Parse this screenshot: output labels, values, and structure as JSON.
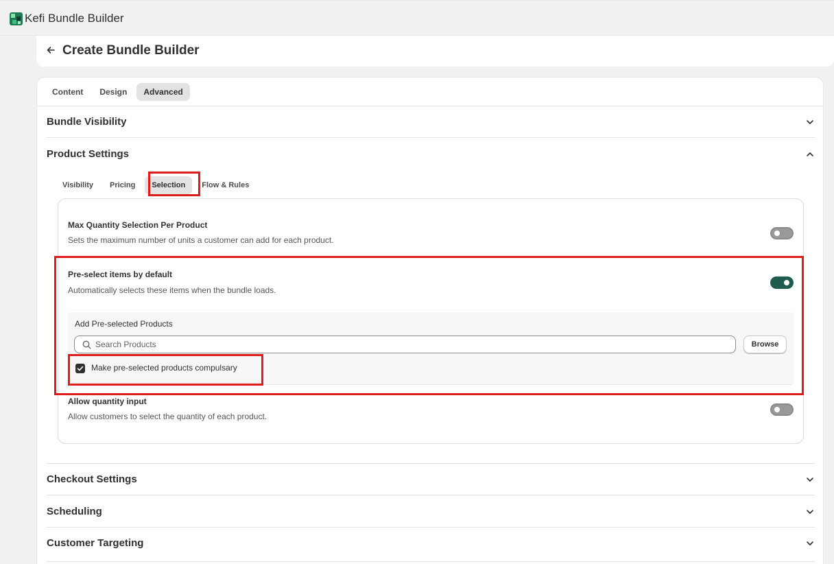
{
  "app": {
    "title": "Kefi Bundle Builder"
  },
  "page": {
    "title": "Create Bundle Builder"
  },
  "tabs": [
    {
      "label": "Content",
      "active": false
    },
    {
      "label": "Design",
      "active": false
    },
    {
      "label": "Advanced",
      "active": true
    }
  ],
  "sections": {
    "bundle_visibility": "Bundle Visibility",
    "product_settings": "Product Settings",
    "checkout_settings": "Checkout Settings",
    "scheduling": "Scheduling",
    "customer_targeting": "Customer Targeting"
  },
  "product_tabs": [
    {
      "label": "Visibility",
      "active": false
    },
    {
      "label": "Pricing",
      "active": false
    },
    {
      "label": "Selection",
      "active": true
    },
    {
      "label": "Flow & Rules",
      "active": false
    }
  ],
  "settings": {
    "max_qty": {
      "title": "Max Quantity Selection Per Product",
      "desc": "Sets the maximum number of units a customer can add for each product.",
      "enabled": false
    },
    "preselect": {
      "title": "Pre-select items by default",
      "desc": "Automatically selects these items when the bundle loads.",
      "enabled": true,
      "add_label": "Add Pre-selected Products",
      "search_placeholder": "Search Products",
      "browse_label": "Browse",
      "compulsory_label": "Make pre-selected products compulsary",
      "compulsory_checked": true
    },
    "allow_qty": {
      "title": "Allow quantity input",
      "desc": "Allow customers to select the quantity of each product.",
      "enabled": false
    }
  },
  "colors": {
    "accent": "#1d5c4d",
    "highlight": "#e01b1b"
  }
}
